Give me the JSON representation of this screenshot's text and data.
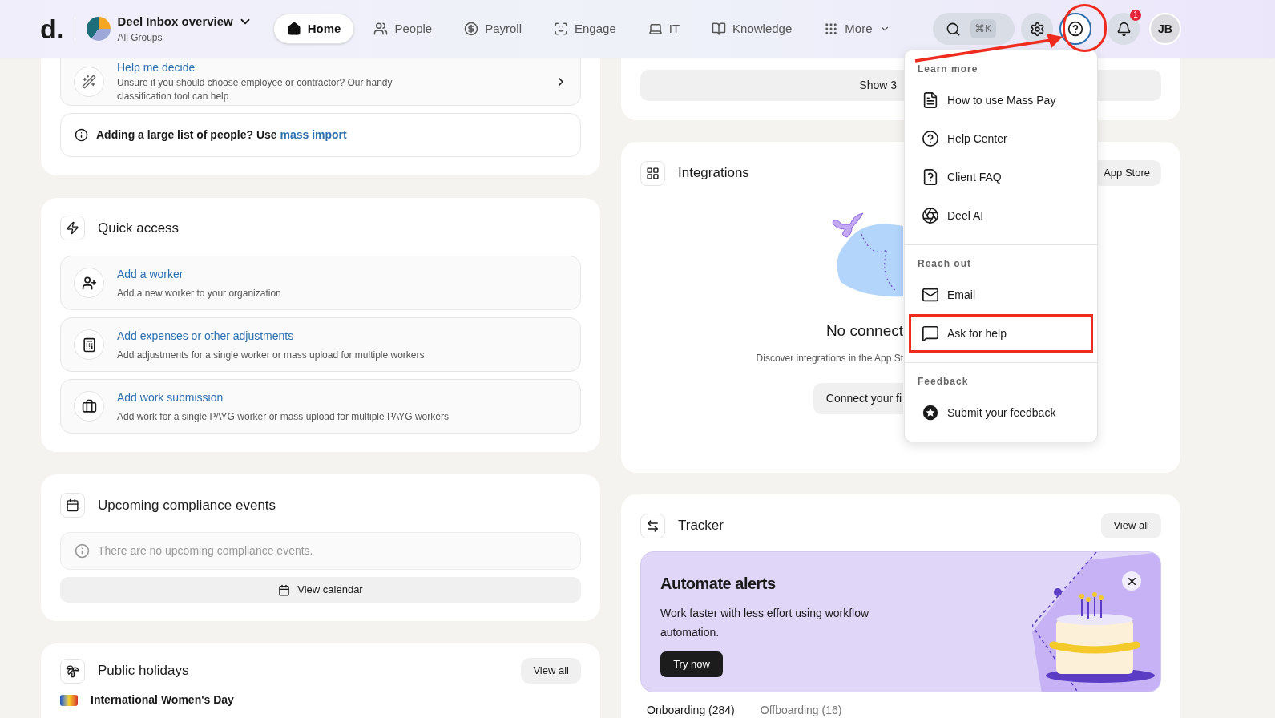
{
  "header": {
    "logo": "d.",
    "workspace": {
      "name": "Deel Inbox overview",
      "subtitle": "All Groups"
    },
    "nav": [
      {
        "label": "Home",
        "selected": true
      },
      {
        "label": "People",
        "selected": false
      },
      {
        "label": "Payroll",
        "selected": false
      },
      {
        "label": "Engage",
        "selected": false
      },
      {
        "label": "IT",
        "selected": false
      },
      {
        "label": "Knowledge",
        "selected": false
      },
      {
        "label": "More",
        "selected": false
      }
    ],
    "search_shortcut": "⌘K",
    "notifications_badge": "1",
    "user_initials": "JB"
  },
  "left": {
    "help_card": {
      "title": "Help me decide",
      "description": "Unsure if you should choose employee or contractor? Our handy classification tool can help",
      "notice_text": "Adding a large list of people? Use",
      "notice_link": "mass import"
    },
    "quick_access": {
      "title": "Quick access",
      "items": [
        {
          "title": "Add a worker",
          "description": "Add a new worker to your organization"
        },
        {
          "title": "Add expenses or other adjustments",
          "description": "Add adjustments for a single worker or mass upload for multiple workers"
        },
        {
          "title": "Add work submission",
          "description": "Add work for a single PAYG worker or mass upload for multiple PAYG workers"
        }
      ]
    },
    "compliance": {
      "title": "Upcoming compliance events",
      "empty_message": "There are no upcoming compliance events.",
      "button": "View calendar"
    },
    "holidays": {
      "title": "Public holidays",
      "button": "View all",
      "items": [
        {
          "name": "International Women's Day"
        }
      ]
    }
  },
  "right": {
    "top_card": {
      "button": "Show 3"
    },
    "integrations": {
      "title": "Integrations",
      "store_button": "App Store",
      "empty_title": "No connect",
      "empty_text": "Discover integrations in the App St",
      "connect_button": "Connect your fi"
    },
    "tracker": {
      "title": "Tracker",
      "button": "View all",
      "banner": {
        "title": "Automate alerts",
        "text": "Work faster with less effort using workflow automation.",
        "button": "Try now"
      },
      "tabs": [
        {
          "label": "Onboarding (284)",
          "selected": true
        },
        {
          "label": "Offboarding (16)",
          "selected": false
        }
      ]
    }
  },
  "help_menu": {
    "sections": [
      {
        "heading": "Learn more",
        "items": [
          {
            "label": "How to use Mass Pay",
            "highlighted": false
          },
          {
            "label": "Help Center",
            "highlighted": false
          },
          {
            "label": "Client FAQ",
            "highlighted": false
          },
          {
            "label": "Deel AI",
            "highlighted": false
          }
        ]
      },
      {
        "heading": "Reach out",
        "items": [
          {
            "label": "Email",
            "highlighted": false
          },
          {
            "label": "Ask for help",
            "highlighted": true
          }
        ]
      },
      {
        "heading": "Feedback",
        "items": [
          {
            "label": "Submit your feedback",
            "highlighted": false
          }
        ]
      }
    ]
  }
}
